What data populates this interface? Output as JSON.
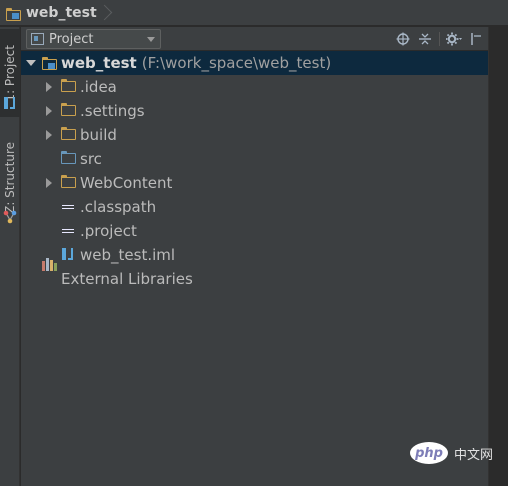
{
  "breadcrumb": {
    "root_label": "web_test"
  },
  "left_tool_strip": {
    "tabs": [
      {
        "label": "1: Project",
        "active": true
      },
      {
        "label": "Z: Structure",
        "active": false
      }
    ]
  },
  "project_panel": {
    "view_selector": {
      "selected": "Project"
    },
    "header_icons": [
      "crosshair-icon",
      "collapse-all-icon",
      "gear-icon",
      "hide-icon"
    ],
    "tree": {
      "root": {
        "name": "web_test",
        "path": "(F:\\work_space\\web_test)",
        "expanded": true
      },
      "items": [
        {
          "label": ".idea",
          "type": "folder",
          "expandable": true
        },
        {
          "label": ".settings",
          "type": "folder",
          "expandable": true
        },
        {
          "label": "build",
          "type": "folder",
          "expandable": true
        },
        {
          "label": "src",
          "type": "source-folder",
          "expandable": false
        },
        {
          "label": "WebContent",
          "type": "folder",
          "expandable": true
        },
        {
          "label": ".classpath",
          "type": "eclipse-file",
          "expandable": false
        },
        {
          "label": ".project",
          "type": "eclipse-file",
          "expandable": false
        },
        {
          "label": "web_test.iml",
          "type": "module-file",
          "expandable": false
        }
      ],
      "external_libraries": {
        "label": "External Libraries"
      }
    }
  },
  "watermark": {
    "logo_text": "php",
    "site_text": "中文网"
  },
  "colors": {
    "panel_bg": "#3c3f41",
    "selection_bg": "#0d293e",
    "folder_color": "#c9a04e",
    "source_folder_color": "#6897bb"
  }
}
